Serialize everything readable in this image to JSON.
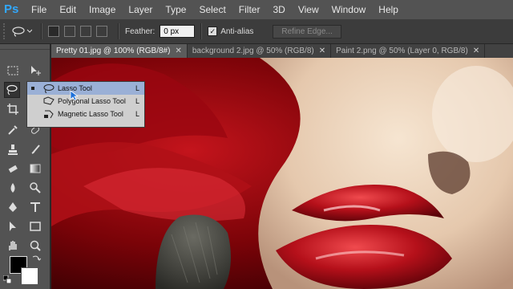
{
  "app": {
    "logo": "Ps"
  },
  "menu": {
    "items": [
      "File",
      "Edit",
      "Image",
      "Layer",
      "Type",
      "Select",
      "Filter",
      "3D",
      "View",
      "Window",
      "Help"
    ]
  },
  "options": {
    "feather_label": "Feather:",
    "feather_value": "0 px",
    "antialias_label": "Anti-alias",
    "antialias_checked": true,
    "refine_label": "Refine Edge..."
  },
  "tabs": [
    {
      "label": "Pretty 01.jpg @ 100% (RGB/8#)",
      "active": true
    },
    {
      "label": "background 2.jpg @ 50% (RGB/8)",
      "active": false
    },
    {
      "label": "Paint 2.png @ 50% (Layer 0, RGB/8)",
      "active": false
    }
  ],
  "flyout": {
    "items": [
      {
        "label": "Lasso Tool",
        "shortcut": "L",
        "selected": true,
        "icon": "lasso-icon"
      },
      {
        "label": "Polygonal Lasso Tool",
        "shortcut": "L",
        "selected": false,
        "icon": "polygonal-lasso-icon"
      },
      {
        "label": "Magnetic Lasso Tool",
        "shortcut": "L",
        "selected": false,
        "icon": "magnetic-lasso-icon"
      }
    ]
  },
  "colors": {
    "foreground": "#000000",
    "background": "#ffffff",
    "accent": "#31a8ff"
  }
}
